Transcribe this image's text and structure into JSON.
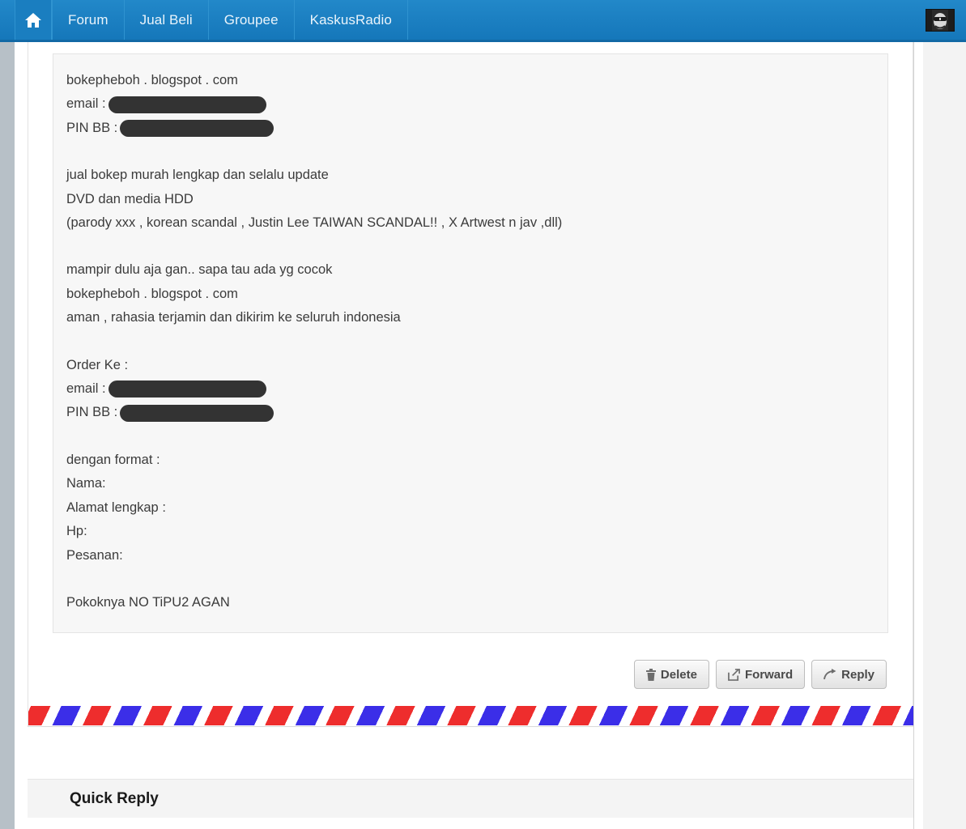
{
  "nav": {
    "home_icon": "home-icon",
    "items": [
      {
        "label": "Forum"
      },
      {
        "label": "Jual Beli"
      },
      {
        "label": "Groupee"
      },
      {
        "label": "KaskusRadio"
      }
    ],
    "avatar_alt": "user-avatar"
  },
  "post": {
    "lines": [
      {
        "text": "bokepheboh . blogspot . com"
      },
      {
        "text": "email :",
        "redact": 195
      },
      {
        "text": "PIN BB :",
        "redact": 190
      },
      {
        "text": ""
      },
      {
        "text": "jual bokep murah lengkap dan selalu update"
      },
      {
        "text": "DVD dan media HDD"
      },
      {
        "text": "(parody xxx , korean scandal , Justin Lee TAIWAN SCANDAL!! , X Artwest n jav ,dll)"
      },
      {
        "text": ""
      },
      {
        "text": "mampir dulu aja gan.. sapa tau ada yg cocok"
      },
      {
        "text": "bokepheboh . blogspot . com"
      },
      {
        "text": "aman , rahasia terjamin dan dikirim ke seluruh indonesia"
      },
      {
        "text": ""
      },
      {
        "text": "Order Ke :"
      },
      {
        "text": "email :",
        "redact": 195
      },
      {
        "text": "PIN BB :",
        "redact": 190
      },
      {
        "text": ""
      },
      {
        "text": "dengan format :"
      },
      {
        "text": "Nama:"
      },
      {
        "text": "Alamat lengkap :"
      },
      {
        "text": "Hp:"
      },
      {
        "text": "Pesanan:"
      },
      {
        "text": ""
      },
      {
        "text": "Pokoknya NO TiPU2 AGAN"
      }
    ]
  },
  "actions": {
    "delete_label": "Delete",
    "forward_label": "Forward",
    "reply_label": "Reply"
  },
  "quick_reply": {
    "title": "Quick Reply"
  },
  "colors": {
    "nav_blue": "#1a7fc1",
    "nav_border": "#1269a5",
    "redaction": "#333333",
    "stripe_red": "#ee2d2d",
    "stripe_blue": "#3b2ee8",
    "post_bg": "#f7f7f7"
  }
}
